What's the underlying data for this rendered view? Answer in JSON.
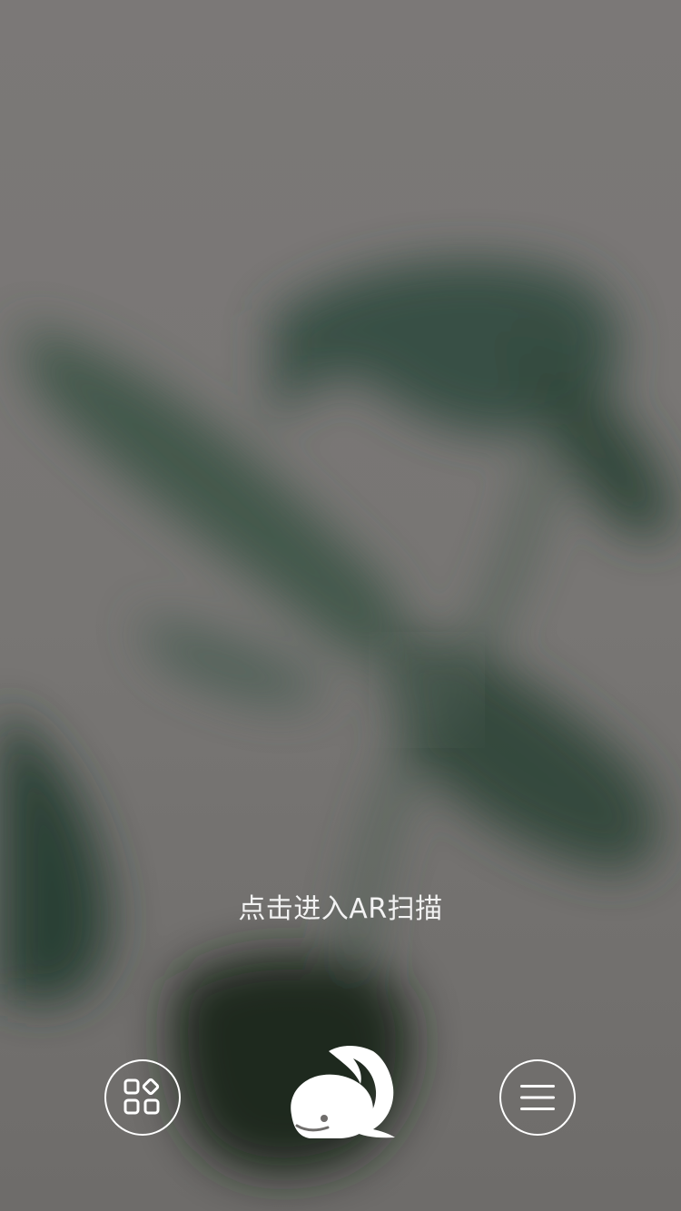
{
  "hint": {
    "text": "点击进入AR扫描"
  },
  "toolbar": {
    "left_icon": "apps-grid-icon",
    "center_icon": "whale-logo-icon",
    "right_icon": "menu-icon"
  },
  "colors": {
    "background": "#777573",
    "foliage": "#2f4a3c",
    "foreground": "#ffffff"
  }
}
